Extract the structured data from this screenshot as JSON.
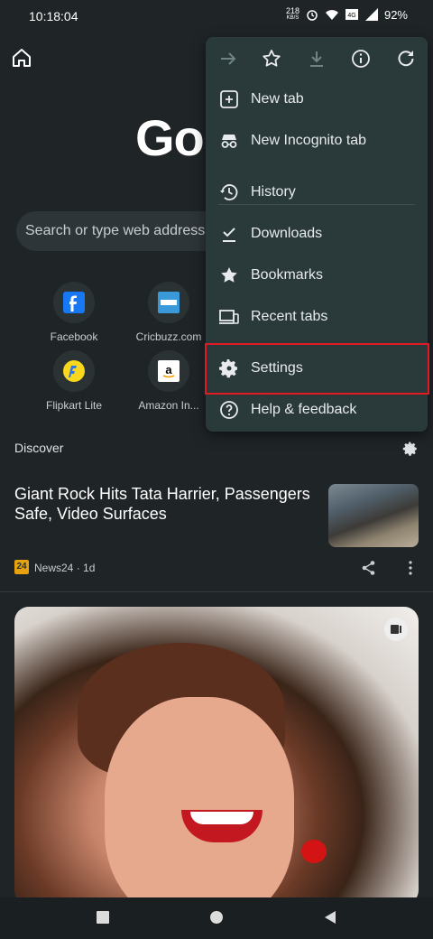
{
  "status_bar": {
    "time": "10:18:04",
    "net_speed_value": "218",
    "net_speed_unit": "KB/S",
    "battery": "92%"
  },
  "page": {
    "logo_text": "Go",
    "search_placeholder": "Search or type web address",
    "tiles": [
      {
        "label": "Facebook",
        "icon": "facebook-icon"
      },
      {
        "label": "Cricbuzz.com",
        "icon": "cricbuzz-icon"
      },
      {
        "label": "Flipkart Lite",
        "icon": "flipkart-icon"
      },
      {
        "label": "Amazon In...",
        "icon": "amazon-icon"
      }
    ],
    "discover_label": "Discover",
    "article": {
      "title": "Giant Rock Hits Tata Harrier, Passengers Safe, Video Surfaces",
      "source_logo_text": "24",
      "source": "News24 · 1d"
    }
  },
  "menu": {
    "toolbar": [
      "forward-icon",
      "bookmark-star-icon",
      "download-icon",
      "info-icon",
      "refresh-icon"
    ],
    "items": [
      {
        "label": "New tab",
        "icon": "new-tab-icon"
      },
      {
        "label": "New Incognito tab",
        "icon": "incognito-icon"
      },
      {
        "label": "History",
        "icon": "history-icon"
      },
      {
        "label": "Downloads",
        "icon": "downloads-icon"
      },
      {
        "label": "Bookmarks",
        "icon": "bookmarks-icon"
      },
      {
        "label": "Recent tabs",
        "icon": "recent-tabs-icon"
      },
      {
        "label": "Settings",
        "icon": "settings-icon"
      },
      {
        "label": "Help & feedback",
        "icon": "help-icon"
      }
    ],
    "highlighted_item": "Settings",
    "highlight_color": "#e01b24"
  },
  "colors": {
    "background": "#1f2427",
    "menu_bg": "#2a3a3a"
  }
}
